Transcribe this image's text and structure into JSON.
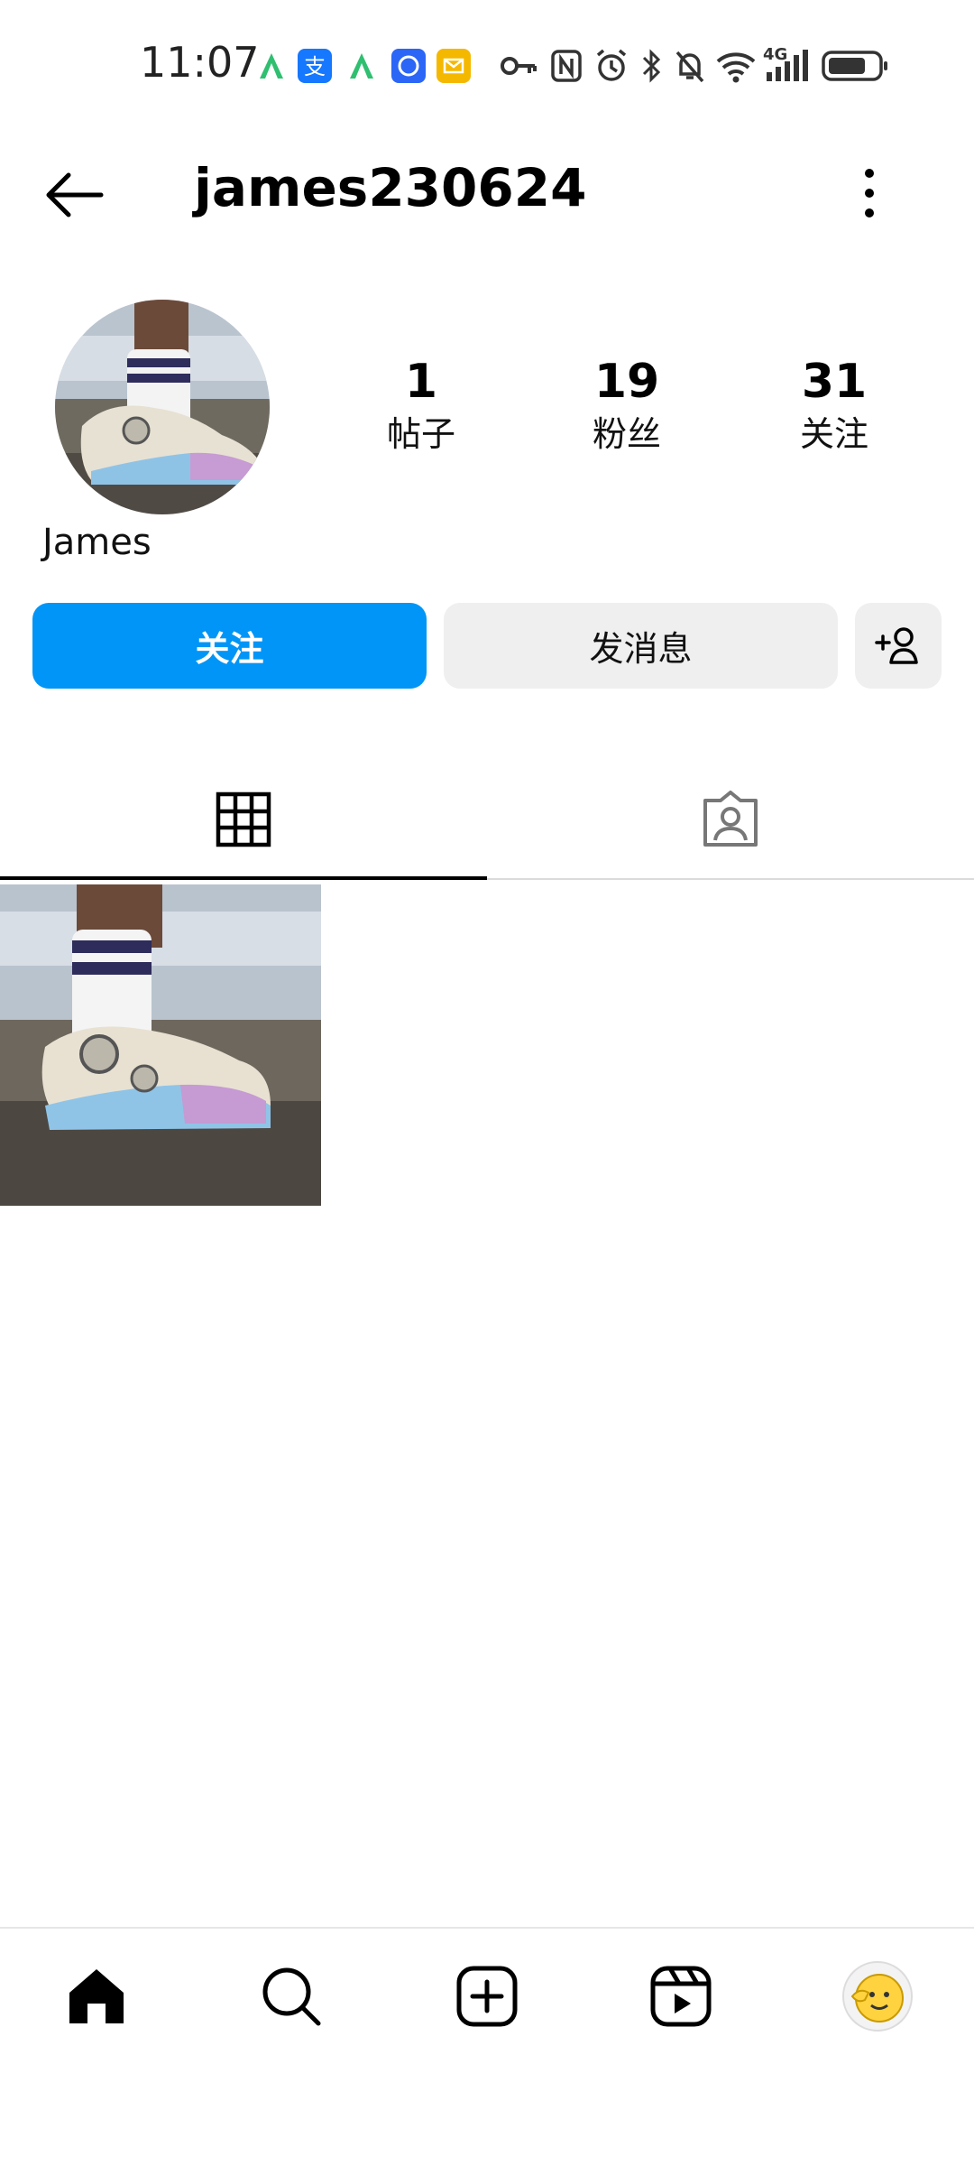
{
  "status_bar": {
    "time": "11:07",
    "network_label": "4G",
    "icons": [
      "app-a-icon",
      "alipay-icon",
      "app-a-icon",
      "security-app-icon",
      "mail-app-icon",
      "vpn-key-icon",
      "nfc-icon",
      "alarm-icon",
      "bluetooth-icon",
      "mute-icon",
      "wifi-icon",
      "signal-icon",
      "battery-icon"
    ]
  },
  "header": {
    "username": "james230624",
    "back_icon": "arrow-left-icon",
    "more_icon": "more-vertical-icon"
  },
  "profile": {
    "display_name": "James",
    "stats": [
      {
        "value": "1",
        "label": "帖子"
      },
      {
        "value": "19",
        "label": "粉丝"
      },
      {
        "value": "31",
        "label": "关注"
      }
    ],
    "buttons": {
      "follow": "关注",
      "message": "发消息"
    }
  },
  "tabs": [
    {
      "icon": "grid-icon",
      "active": true
    },
    {
      "icon": "tagged-person-icon",
      "active": false
    }
  ],
  "posts": [
    {
      "icon": "sneaker-photo"
    }
  ],
  "bottom_nav": [
    {
      "icon": "home-icon"
    },
    {
      "icon": "search-icon"
    },
    {
      "icon": "create-post-icon"
    },
    {
      "icon": "reels-icon"
    },
    {
      "icon": "profile-avatar"
    }
  ],
  "colors": {
    "accent": "#0095f6",
    "secondary_button": "#efefef"
  }
}
